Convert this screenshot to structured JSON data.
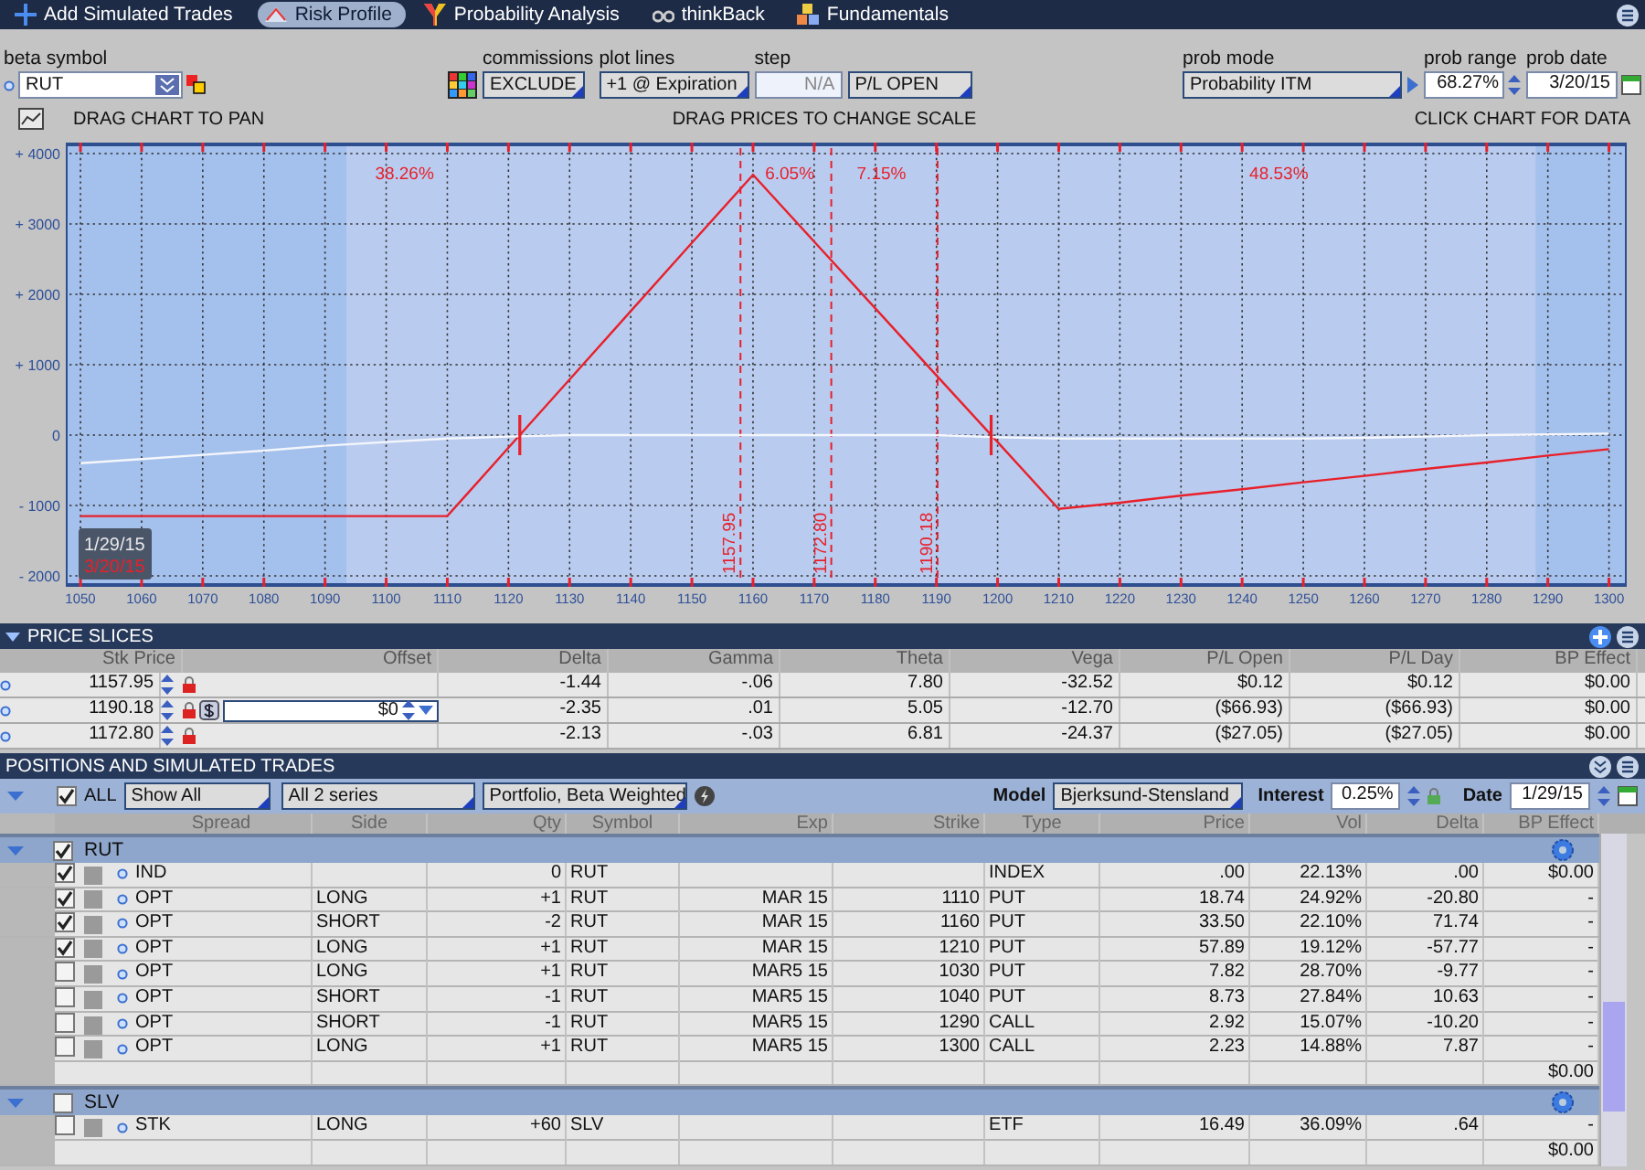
{
  "tabs": [
    {
      "label": "Add Simulated Trades",
      "selected": false
    },
    {
      "label": "Risk Profile",
      "selected": true
    },
    {
      "label": "Probability Analysis",
      "selected": false
    },
    {
      "label": "thinkBack",
      "selected": false
    },
    {
      "label": "Fundamentals",
      "selected": false
    }
  ],
  "controls": {
    "beta_symbol": {
      "label": "beta symbol",
      "value": "RUT"
    },
    "commissions": {
      "label": "commissions",
      "value": "EXCLUDE"
    },
    "plot_lines": {
      "label": "plot lines",
      "value": "+1 @ Expiration"
    },
    "step": {
      "label": "step",
      "placeholder": "N/A"
    },
    "pl_mode": {
      "value": "P/L OPEN"
    },
    "prob_mode": {
      "label": "prob mode",
      "value": "Probability ITM"
    },
    "prob_range": {
      "label": "prob range",
      "value": "68.27%"
    },
    "prob_date": {
      "label": "prob date",
      "value": "3/20/15"
    }
  },
  "chart_hints": [
    "DRAG CHART TO PAN",
    "DRAG PRICES TO CHANGE SCALE",
    "CLICK CHART FOR DATA"
  ],
  "chart": {
    "chart_data": {
      "type": "line",
      "x": [
        1050,
        1060,
        1070,
        1080,
        1090,
        1100,
        1110,
        1120,
        1130,
        1140,
        1150,
        1160,
        1170,
        1180,
        1190,
        1200,
        1210,
        1220,
        1230,
        1240,
        1250,
        1260,
        1270,
        1280,
        1290,
        1300
      ],
      "grid": true,
      "series": [
        {
          "name": "3/20/15",
          "color": "#e8202a",
          "values": [
            -1150,
            -1150,
            -1150,
            -1150,
            -1150,
            -1150,
            -1150,
            -180,
            790,
            1760,
            2730,
            3700,
            2750,
            1800,
            850,
            -100,
            -1050,
            -960,
            -860,
            -770,
            -670,
            -580,
            -480,
            -390,
            -290,
            -200
          ]
        },
        {
          "name": "1/29/15",
          "color": "#f4f6fb",
          "values": [
            -400,
            -340,
            -280,
            -220,
            -150,
            -100,
            -50,
            -20,
            0,
            0,
            0,
            0,
            0,
            0,
            0,
            -30,
            -50,
            -50,
            -50,
            -50,
            -50,
            -40,
            -20,
            0,
            10,
            20
          ]
        }
      ],
      "xlim": [
        1047.9,
        1302.6
      ],
      "ylim": [
        -2130,
        4130
      ],
      "xticks": [
        1050,
        1060,
        1070,
        1080,
        1090,
        1100,
        1110,
        1120,
        1130,
        1140,
        1150,
        1160,
        1170,
        1180,
        1190,
        1200,
        1210,
        1220,
        1230,
        1240,
        1250,
        1260,
        1270,
        1280,
        1290,
        1300
      ],
      "yticks": [
        {
          "value": 4000,
          "label": "+ 4000"
        },
        {
          "value": 3000,
          "label": "+ 3000"
        },
        {
          "value": 2000,
          "label": "+ 2000"
        },
        {
          "value": 1000,
          "label": "+ 1000"
        },
        {
          "value": 0,
          "label": "0"
        },
        {
          "value": -1000,
          "label": "- 1000"
        },
        {
          "value": -2000,
          "label": "- 2000"
        }
      ],
      "bands": [
        {
          "axis": "x",
          "from": 1047.9,
          "to": 1093.5
        },
        {
          "axis": "x",
          "from": 1288,
          "to": 1302.6
        }
      ],
      "ref_lines": [
        {
          "axis": "x",
          "value": 1157.95,
          "label": "1157.95"
        },
        {
          "axis": "x",
          "value": 1172.8,
          "label": "1172.80"
        },
        {
          "axis": "x",
          "value": 1190.18,
          "label": "1190.18"
        }
      ],
      "annotations": [
        "38.26%",
        "6.05%",
        "7.15%",
        "48.53%"
      ]
    }
  },
  "price_slices": {
    "title": "PRICE SLICES",
    "columns": [
      "Stk Price",
      "Offset",
      "Delta",
      "Gamma",
      "Theta",
      "Vega",
      "P/L Open",
      "P/L Day",
      "BP Effect"
    ],
    "rows": [
      {
        "stk_price": "1157.95",
        "values": [
          "-1.44",
          "-.06",
          "7.80",
          "-32.52",
          "$0.12",
          "$0.12",
          "$0.00"
        ]
      },
      {
        "stk_price": "1190.18",
        "offset": "$0",
        "values": [
          "-2.35",
          ".01",
          "5.05",
          "-12.70",
          "($66.93)",
          "($66.93)",
          "$0.00"
        ]
      },
      {
        "stk_price": "1172.80",
        "values": [
          "-2.13",
          "-.03",
          "6.81",
          "-24.37",
          "($27.05)",
          "($27.05)",
          "$0.00"
        ]
      }
    ]
  },
  "positions": {
    "title": "POSITIONS AND SIMULATED TRADES",
    "all": {
      "label": "ALL",
      "checked": true
    },
    "filters": [
      "Show All",
      "All 2 series",
      "Portfolio, Beta Weighted"
    ],
    "model": {
      "label": "Model",
      "value": "Bjerksund-Stensland"
    },
    "interest": {
      "label": "Interest",
      "value": "0.25%"
    },
    "date": {
      "label": "Date",
      "value": "1/29/15"
    },
    "columns": [
      "Spread",
      "Side",
      "Qty",
      "Symbol",
      "Exp",
      "Strike",
      "Type",
      "Price",
      "Vol",
      "Delta",
      "BP Effect"
    ],
    "groups": [
      {
        "name": "RUT",
        "checked": true,
        "total": "$0.00",
        "rows": [
          {
            "checked": true,
            "spread": "IND",
            "qty": "0",
            "symbol": "RUT",
            "type": "INDEX",
            "price": ".00",
            "vol": "22.13%",
            "delta": ".00",
            "bp": "$0.00"
          },
          {
            "checked": true,
            "spread": "OPT",
            "side": "LONG",
            "qty": "+1",
            "symbol": "RUT",
            "exp": "MAR 15",
            "strike": "1110",
            "type": "PUT",
            "price": "18.74",
            "vol": "24.92%",
            "delta": "-20.80",
            "bp": "-"
          },
          {
            "checked": true,
            "spread": "OPT",
            "side": "SHORT",
            "qty": "-2",
            "symbol": "RUT",
            "exp": "MAR 15",
            "strike": "1160",
            "type": "PUT",
            "price": "33.50",
            "vol": "22.10%",
            "delta": "71.74",
            "bp": "-"
          },
          {
            "checked": true,
            "spread": "OPT",
            "side": "LONG",
            "qty": "+1",
            "symbol": "RUT",
            "exp": "MAR 15",
            "strike": "1210",
            "type": "PUT",
            "price": "57.89",
            "vol": "19.12%",
            "delta": "-57.77",
            "bp": "-"
          },
          {
            "checked": false,
            "spread": "OPT",
            "side": "LONG",
            "qty": "+1",
            "symbol": "RUT",
            "exp": "MAR5 15",
            "strike": "1030",
            "type": "PUT",
            "price": "7.82",
            "vol": "28.70%",
            "delta": "-9.77",
            "bp": "-"
          },
          {
            "checked": false,
            "spread": "OPT",
            "side": "SHORT",
            "qty": "-1",
            "symbol": "RUT",
            "exp": "MAR5 15",
            "strike": "1040",
            "type": "PUT",
            "price": "8.73",
            "vol": "27.84%",
            "delta": "10.63",
            "bp": "-"
          },
          {
            "checked": false,
            "spread": "OPT",
            "side": "SHORT",
            "qty": "-1",
            "symbol": "RUT",
            "exp": "MAR5 15",
            "strike": "1290",
            "type": "CALL",
            "price": "2.92",
            "vol": "15.07%",
            "delta": "-10.20",
            "bp": "-"
          },
          {
            "checked": false,
            "spread": "OPT",
            "side": "LONG",
            "qty": "+1",
            "symbol": "RUT",
            "exp": "MAR5 15",
            "strike": "1300",
            "type": "CALL",
            "price": "2.23",
            "vol": "14.88%",
            "delta": "7.87",
            "bp": "-"
          }
        ]
      },
      {
        "name": "SLV",
        "checked": false,
        "total": "$0.00",
        "rows": [
          {
            "checked": false,
            "spread": "STK",
            "side": "LONG",
            "qty": "+60",
            "symbol": "SLV",
            "type": "ETF",
            "price": "16.49",
            "vol": "36.09%",
            "delta": ".64",
            "bp": "-"
          }
        ]
      }
    ]
  }
}
